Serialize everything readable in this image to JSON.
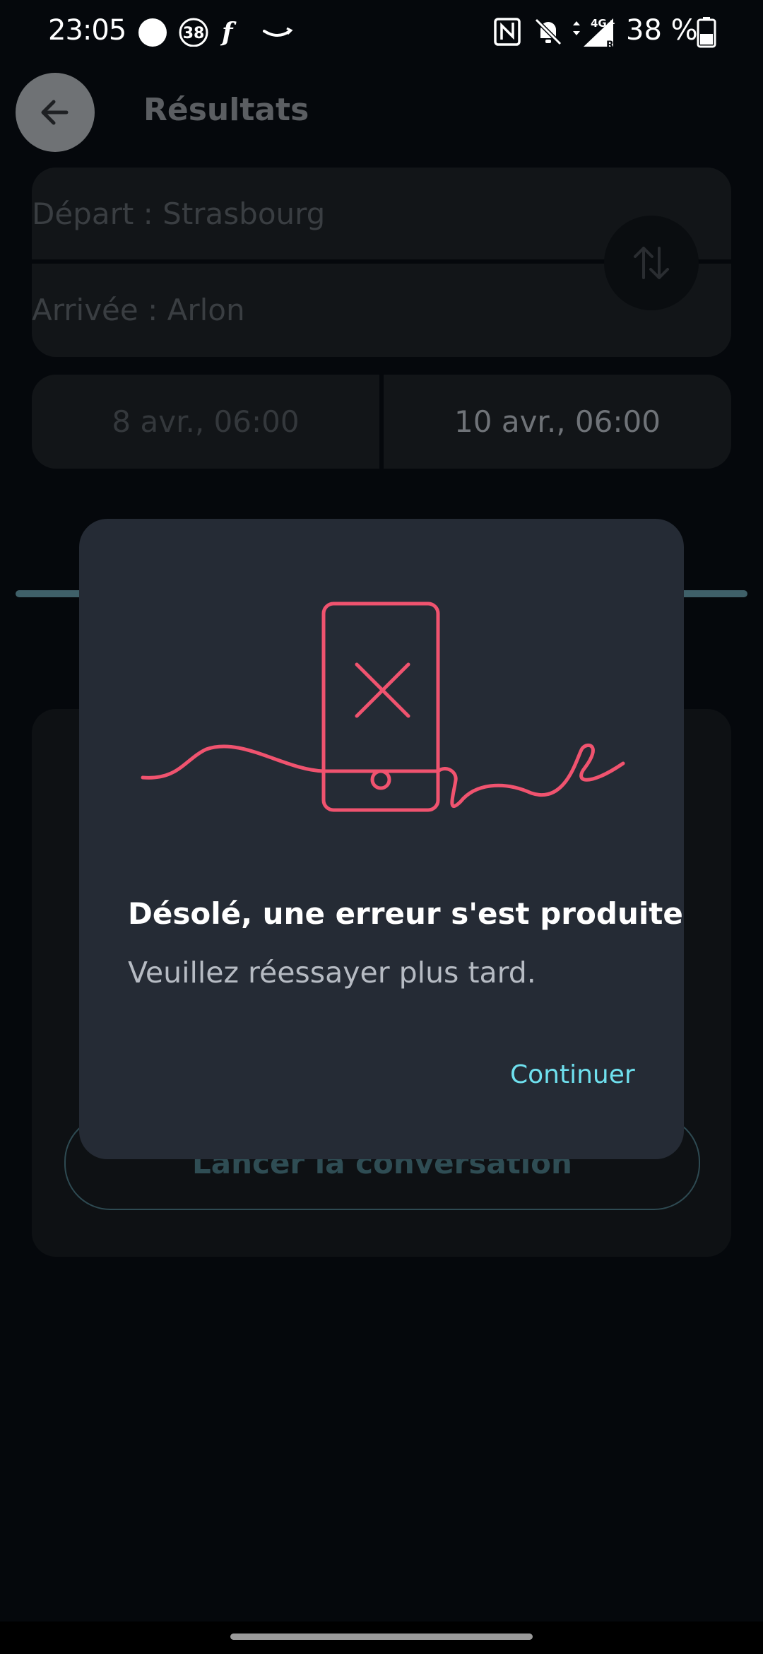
{
  "status_bar": {
    "time": "23:05",
    "notification_badge": "38",
    "battery_percent": "38 %",
    "network": "4G+",
    "network_sub": "R",
    "icons": [
      "circle-icon",
      "badge-38-icon",
      "f-app-icon",
      "amazon-smile-icon",
      "nfc-icon",
      "bell-off-icon",
      "signal-icon",
      "battery-icon"
    ]
  },
  "header": {
    "title": "Résultats"
  },
  "route": {
    "departure": "Départ : Strasbourg",
    "arrival": "Arrivée : Arlon"
  },
  "dates": {
    "outbound": "8 avr., 06:00",
    "return": "10 avr., 06:00"
  },
  "background": {
    "button_label": "Lancer la conversation"
  },
  "dialog": {
    "title": "Désolé, une erreur s'est produite",
    "message": "Veuillez réessayer plus tard.",
    "continue_label": "Continuer",
    "illustration": "phone-error-icon"
  },
  "colors": {
    "background": "#05080c",
    "dialog": "#252b35",
    "accent": "#6fe0ee",
    "error": "#f0536f"
  }
}
